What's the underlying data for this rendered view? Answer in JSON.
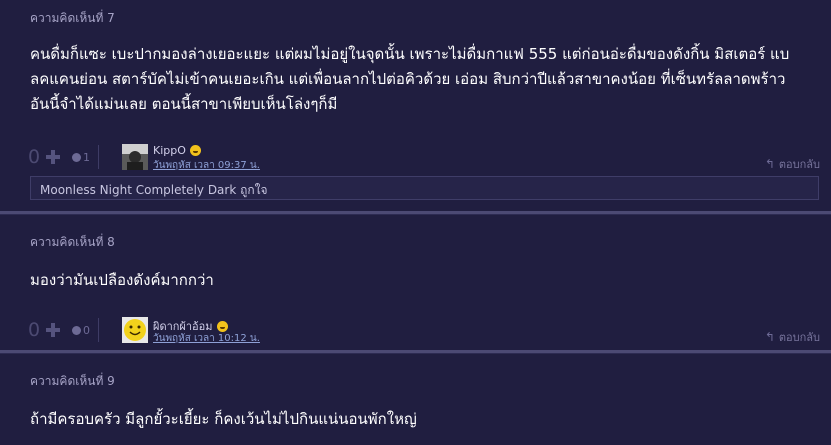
{
  "comments": [
    {
      "header": "ความคิดเห็นที่ 7",
      "body_lines": [
        "คนดื่มก็แซะ เบะปากมองล่างเยอะแยะ แต่ผมไม่อยู่ในจุดนั้น เพราะไม่ดื่มกาแฟ 555 แต่ก่อนอ่ะดื่มของดังกิ้น มิสเตอร์ แบ",
        "ลคแคนย่อน สตาร์บัคไม่เข้าคนเยอะเกิน แต่เพื่อนลากไปต่อคิวด้วย เอ่อม สิบกว่าปีแล้วสาขาคงน้อย ที่เซ็นทรัลลาดพร้าว",
        "อันนี้จำได้แม่นเลย ตอนนี้สาขาเพียบเห็นโล่งๆก็มี"
      ],
      "vote_count": "0",
      "emotion_count": "1",
      "username": "KippO",
      "date": "วันพฤหัส เวลา 09:37 น.",
      "reply_label": "ตอบกลับ",
      "sub_reply": "Moonless Night Completely Dark ถูกใจ"
    },
    {
      "header": "ความคิดเห็นที่ 8",
      "body_lines": [
        "มองว่ามันเปลืองดังค์มากกว่า"
      ],
      "vote_count": "0",
      "emotion_count": "0",
      "username": "ผิดากผ้าอ้อม",
      "date": "วันพฤหัส เวลา 10:12 น.",
      "reply_label": "ตอบกลับ"
    },
    {
      "header": "ความคิดเห็นที่ 9",
      "body_lines": [
        "ถ้ามีครอบครัว มีลูกยั้วะเยี้ยะ ก็คงเว้นไม่ไปกินแน่นอนพักใหญ่"
      ]
    }
  ],
  "colors": {
    "background": "#201e40",
    "divider": "#4c4a74",
    "date_link": "#8ea0d6"
  }
}
